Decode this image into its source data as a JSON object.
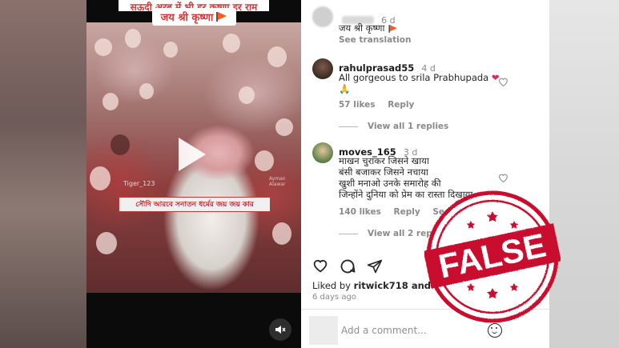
{
  "video": {
    "title_line1": "सऊदी अरब में भी हर कृष्णा हर राम",
    "title_line2": "जय श्री कृष्णा",
    "caption": "সৌদি আরবে সনাতন ধর্মের জয় জয় কার",
    "watermark": "Tiger_123",
    "watermark2": "Ayman Alawar"
  },
  "comments": [
    {
      "username": "",
      "time": "6 d",
      "text": "जय श्री कृष्णा",
      "see_translation": "See translation"
    },
    {
      "username": "rahulprasad55",
      "time": "4 d",
      "text_line1": "All gorgeous to srila Prabhupada",
      "text_line2": "🙏",
      "likes": "57 likes",
      "reply": "Reply",
      "view_replies": "View all 1 replies"
    },
    {
      "username": "moves_165",
      "time": "3 d",
      "text_lines": [
        "माखन चुराकर जिसने खाया",
        "बंसी बजाकर जिसने नचाया",
        "खुशी मनाओ उनके समारोह की",
        "जिन्होंने दुनिया को प्रेम का रास्ता दिखाया"
      ],
      "likes": "140 likes",
      "reply": "Reply",
      "see_translation": "See translation",
      "view_replies": "View all 2 replies"
    }
  ],
  "post": {
    "liked_by_prefix": "Liked by ",
    "liked_by_user": "ritwick718",
    "liked_by_suffix": " and oth",
    "days_ago": "6 days ago",
    "comment_placeholder": "Add a comment..."
  },
  "stamp": {
    "text": "FALSE",
    "color": "#c8102e"
  }
}
